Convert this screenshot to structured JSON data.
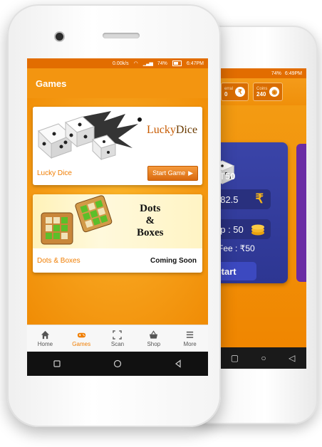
{
  "front": {
    "status": {
      "speed": "0.00k/s",
      "battery": "74%",
      "time": "6:47PM"
    },
    "title": "Games",
    "games": [
      {
        "name": "Lucky Dice",
        "banner_text_a": "Lucky",
        "banner_text_b": "Dice",
        "action": "Start Game"
      },
      {
        "name": "Dots & Boxes",
        "banner_line1": "Dots",
        "banner_line2": "&",
        "banner_line3": "Boxes",
        "action": "Coming Soon"
      }
    ],
    "nav": [
      {
        "label": "Home",
        "icon": "home-icon"
      },
      {
        "label": "Games",
        "icon": "gamepad-icon",
        "active": true
      },
      {
        "label": "Scan",
        "icon": "scan-icon"
      },
      {
        "label": "Shop",
        "icon": "basket-icon"
      },
      {
        "label": "More",
        "icon": "menu-icon"
      }
    ]
  },
  "back": {
    "status": {
      "battery": "74%",
      "time": "6:49PM"
    },
    "referral_label": "erral",
    "referral_value": "0",
    "coins_label": "Coins",
    "coins_value": "240",
    "game_title": "T50",
    "row1": ": 82.5",
    "row2": "up : 50",
    "fee": "Fee : ₹50",
    "start": "Start",
    "rupee": "₹"
  },
  "colors": {
    "orange": "#f39510",
    "accent": "#f07d00",
    "blue": "#2d3692"
  }
}
